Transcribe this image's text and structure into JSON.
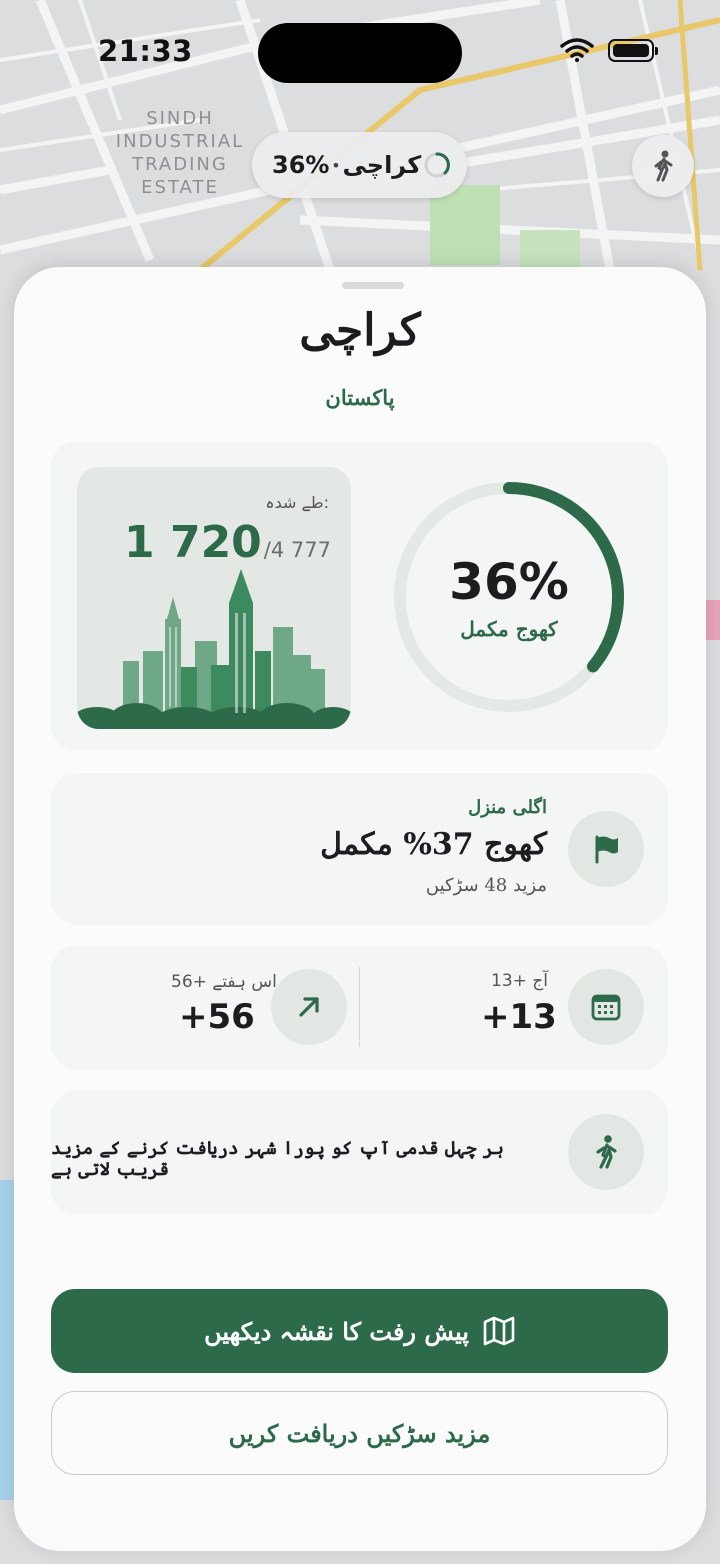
{
  "status_bar": {
    "time": "21:33"
  },
  "map": {
    "area_label": "SINDH INDUSTRIAL TRADING ESTATE"
  },
  "progress_pill": {
    "percent": "36%",
    "separator": "•",
    "city": "کراچی"
  },
  "sheet": {
    "title": "کراچی",
    "subtitle": "پاکستان",
    "summary": {
      "done_label": "طے شدہ:",
      "done_count": "1 720",
      "done_total": "/4 777",
      "percent": "36%",
      "percent_value": 0.36,
      "percent_caption": "کھوج مکمل"
    },
    "next_goal": {
      "label": "اگلی منزل",
      "text": "کھوج 37% مکمل",
      "more": "مزید 48 سڑکیں"
    },
    "stats": {
      "today_label": "آج +13",
      "today_value": "+13",
      "week_label": "اس ہفتے +56",
      "week_value": "+56"
    },
    "motto": "ہر چہل قدمی آپ کو پورا شہر دریافت کرنے کے مزید قریب لاتی ہے",
    "primary_button": "پیش رفت کا نقشہ دیکھیں",
    "secondary_button": "مزید سڑکیں دریافت کریں"
  },
  "colors": {
    "accent": "#2d6a4a",
    "ring_track": "#e4e9e6",
    "card": "#f4f6f5"
  },
  "icons": [
    "wifi-icon",
    "battery-icon",
    "loading-spinner-icon",
    "walk-icon",
    "flag-icon",
    "calendar-icon",
    "trend-arrow-icon",
    "map-icon"
  ]
}
